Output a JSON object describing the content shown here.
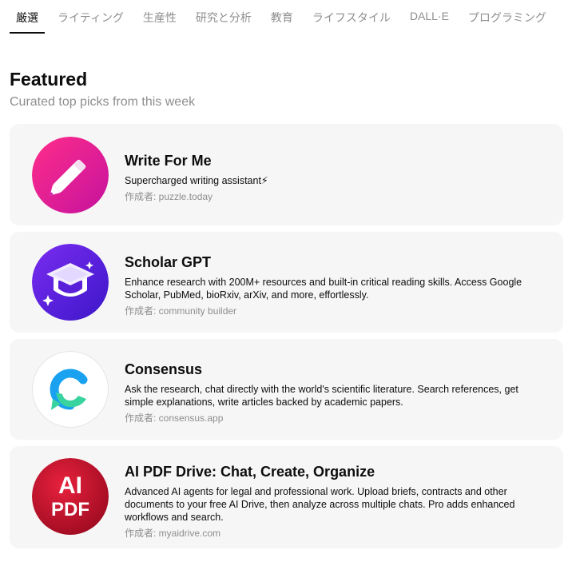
{
  "tabs": [
    {
      "label": "厳選",
      "active": true
    },
    {
      "label": "ライティング",
      "active": false
    },
    {
      "label": "生産性",
      "active": false
    },
    {
      "label": "研究と分析",
      "active": false
    },
    {
      "label": "教育",
      "active": false
    },
    {
      "label": "ライフスタイル",
      "active": false
    },
    {
      "label": "DALL·E",
      "active": false
    },
    {
      "label": "プログラミング",
      "active": false
    }
  ],
  "section": {
    "title": "Featured",
    "subtitle": "Curated top picks from this week"
  },
  "gpts": [
    {
      "name": "Write For Me",
      "description": "Supercharged writing assistant⚡",
      "author": "作成者: puzzle.today",
      "icon": "pencil-icon"
    },
    {
      "name": "Scholar GPT",
      "description": "Enhance research with 200M+ resources and built-in critical reading skills. Access Google Scholar, PubMed, bioRxiv, arXiv, and more, effortlessly.",
      "author": "作成者: community builder",
      "icon": "graduation-cap-icon"
    },
    {
      "name": "Consensus",
      "description": "Ask the research, chat directly with the world's scientific literature. Search references, get simple explanations, write articles backed by academic papers.",
      "author": "作成者: consensus.app",
      "icon": "consensus-logo-icon"
    },
    {
      "name": "AI PDF Drive: Chat, Create, Organize",
      "description": "Advanced AI agents for legal and professional work. Upload briefs, contracts and other documents to your free AI Drive, then analyze across multiple chats. Pro adds enhanced workflows and search.",
      "author": "作成者: myaidrive.com",
      "icon": "ai-pdf-logo-icon",
      "logo_text": [
        "AI",
        "PDF"
      ]
    }
  ],
  "colors": {
    "card_bg": "#f6f6f6",
    "muted_text": "#8e8e8e",
    "write_for_me": "#e5189a",
    "scholar": "#6a1fe0",
    "consensus_blue": "#1aa2f0",
    "consensus_green": "#38d39f",
    "ai_pdf_red": "#c8102e"
  }
}
